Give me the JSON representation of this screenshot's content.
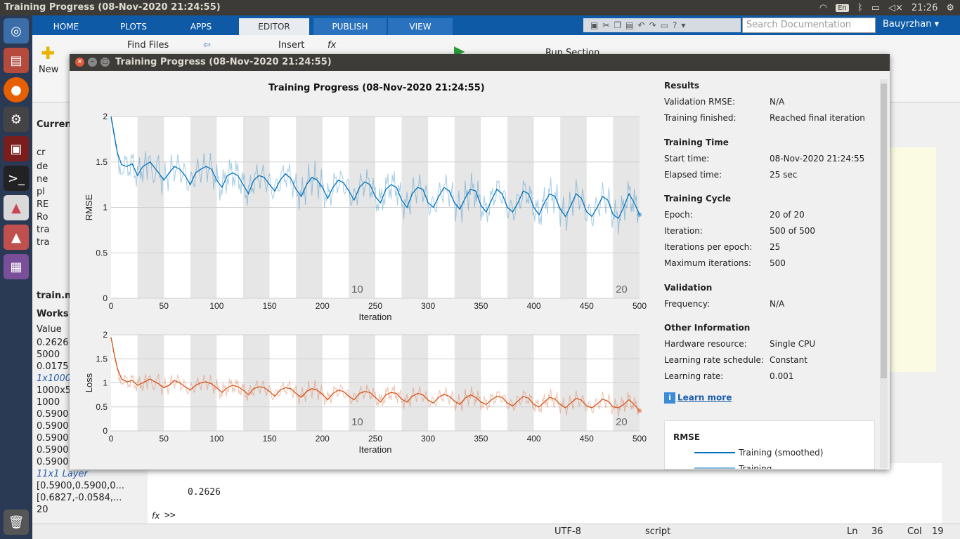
{
  "os": {
    "window_title": "Training Progress (08-Nov-2020 21:24:55)",
    "lang": "En",
    "clock": "21:26"
  },
  "matlab": {
    "tabs": [
      "HOME",
      "PLOTS",
      "APPS",
      "EDITOR",
      "PUBLISH",
      "VIEW"
    ],
    "active_tab": "EDITOR",
    "search_placeholder": "Search Documentation",
    "user": "Bauyrzhan",
    "ribbon": {
      "new": "New",
      "find_files": "Find Files",
      "insert": "Insert",
      "fx": "fx",
      "run_section": "Run Section"
    },
    "current_folder": "Curren",
    "file_rows": [
      "cr",
      "de",
      "ne",
      "pl",
      "RE",
      "Ro",
      "tra",
      "tra"
    ],
    "editor_file": "train.m",
    "workspace": "Works",
    "workspace_header": "Value",
    "workspace_values": [
      "0.2626",
      "5000",
      "0.0175",
      "1x1000",
      "1000x5",
      "1000",
      "0.5900",
      "0.5900",
      "0.5900",
      "0.5900",
      "0.5900",
      "11x1 Layer",
      "[0.5900,0.5900,0...",
      "[0.6827,-0.0584,...",
      "20"
    ],
    "cmd_output": "0.2626",
    "cmd_prompt": ">>",
    "cmd_fx": "fx",
    "status": {
      "encoding": "UTF-8",
      "type": "script",
      "ln_label": "Ln",
      "ln": "36",
      "col_label": "Col",
      "col": "19"
    }
  },
  "window": {
    "title": "Training Progress (08-Nov-2020 21:24:55)",
    "plot_title": "Training Progress (08-Nov-2020 21:24:55)"
  },
  "info": {
    "results_h": "Results",
    "validation_rmse_label": "Validation RMSE:",
    "validation_rmse": "N/A",
    "training_finished_label": "Training finished:",
    "training_finished": "Reached final iteration",
    "training_time_h": "Training Time",
    "start_time_label": "Start time:",
    "start_time": "08-Nov-2020 21:24:55",
    "elapsed_time_label": "Elapsed time:",
    "elapsed_time": "25 sec",
    "training_cycle_h": "Training Cycle",
    "epoch_label": "Epoch:",
    "epoch": "20 of 20",
    "iteration_label": "Iteration:",
    "iteration": "500 of 500",
    "iter_per_epoch_label": "Iterations per epoch:",
    "iter_per_epoch": "25",
    "max_iter_label": "Maximum iterations:",
    "max_iter": "500",
    "validation_h": "Validation",
    "frequency_label": "Frequency:",
    "frequency": "N/A",
    "other_h": "Other Information",
    "hardware_label": "Hardware resource:",
    "hardware": "Single CPU",
    "lr_schedule_label": "Learning rate schedule:",
    "lr_schedule": "Constant",
    "lr_label": "Learning rate:",
    "lr": "0.001",
    "learn_more": "Learn more",
    "legend_title": "RMSE",
    "legend_smoothed": "Training (smoothed)",
    "legend_training": "Training"
  },
  "chart_data": [
    {
      "type": "line",
      "ylabel": "RMSE",
      "xlabel": "Iteration",
      "xlim": [
        0,
        500
      ],
      "ylim": [
        0,
        2
      ],
      "xticks": [
        0,
        50,
        100,
        150,
        200,
        250,
        300,
        350,
        400,
        450,
        500
      ],
      "yticks": [
        0,
        0.5,
        1,
        1.5,
        2
      ],
      "epoch_labels": [
        "10",
        "20"
      ],
      "color": "#0072bd",
      "series": [
        {
          "name": "Training (smoothed)",
          "x": [
            0,
            3,
            6,
            10,
            15,
            20,
            25,
            30,
            37,
            45,
            50,
            55,
            60,
            65,
            70,
            75,
            80,
            85,
            90,
            95,
            100,
            105,
            110,
            115,
            120,
            125,
            130,
            135,
            140,
            145,
            150,
            155,
            160,
            165,
            170,
            175,
            180,
            185,
            190,
            195,
            200,
            205,
            210,
            215,
            220,
            225,
            230,
            235,
            240,
            245,
            250,
            255,
            260,
            265,
            270,
            275,
            280,
            285,
            290,
            295,
            300,
            305,
            310,
            315,
            320,
            325,
            330,
            335,
            340,
            345,
            350,
            355,
            360,
            365,
            370,
            375,
            380,
            385,
            390,
            395,
            400,
            405,
            410,
            415,
            420,
            425,
            430,
            435,
            440,
            445,
            450,
            455,
            460,
            465,
            470,
            475,
            480,
            485,
            490,
            495,
            500
          ],
          "y": [
            2.0,
            1.8,
            1.6,
            1.47,
            1.45,
            1.48,
            1.35,
            1.45,
            1.5,
            1.38,
            1.3,
            1.38,
            1.45,
            1.42,
            1.35,
            1.25,
            1.38,
            1.42,
            1.45,
            1.42,
            1.3,
            1.22,
            1.35,
            1.38,
            1.35,
            1.25,
            1.15,
            1.3,
            1.35,
            1.33,
            1.25,
            1.18,
            1.3,
            1.37,
            1.32,
            1.2,
            1.12,
            1.25,
            1.33,
            1.3,
            1.22,
            1.1,
            1.22,
            1.3,
            1.27,
            1.18,
            1.08,
            1.22,
            1.28,
            1.25,
            1.12,
            1.05,
            1.2,
            1.25,
            1.22,
            1.08,
            1.0,
            1.15,
            1.22,
            1.2,
            1.05,
            1.0,
            1.12,
            1.22,
            1.18,
            1.05,
            0.98,
            1.1,
            1.2,
            1.18,
            1.02,
            0.95,
            1.08,
            1.2,
            1.15,
            1.0,
            0.95,
            1.05,
            1.18,
            1.15,
            1.0,
            0.92,
            1.05,
            1.15,
            1.12,
            0.98,
            0.9,
            1.02,
            1.15,
            1.1,
            0.95,
            0.9,
            1.0,
            1.12,
            1.08,
            0.92,
            0.88,
            1.0,
            1.15,
            1.05,
            0.92
          ]
        }
      ]
    },
    {
      "type": "line",
      "ylabel": "Loss",
      "xlabel": "Iteration",
      "xlim": [
        0,
        500
      ],
      "ylim": [
        0,
        2
      ],
      "xticks": [
        0,
        50,
        100,
        150,
        200,
        250,
        300,
        350,
        400,
        450,
        500
      ],
      "yticks": [
        0,
        0.5,
        1,
        1.5,
        2
      ],
      "epoch_labels": [
        "10",
        "20"
      ],
      "color": "#d95319",
      "series": [
        {
          "name": "Training (smoothed)",
          "x": [
            0,
            3,
            6,
            10,
            15,
            20,
            25,
            30,
            37,
            45,
            50,
            55,
            60,
            65,
            70,
            75,
            80,
            85,
            90,
            95,
            100,
            105,
            110,
            115,
            120,
            125,
            130,
            135,
            140,
            145,
            150,
            155,
            160,
            165,
            170,
            175,
            180,
            185,
            190,
            195,
            200,
            205,
            210,
            215,
            220,
            225,
            230,
            235,
            240,
            245,
            250,
            255,
            260,
            265,
            270,
            275,
            280,
            285,
            290,
            295,
            300,
            305,
            310,
            315,
            320,
            325,
            330,
            335,
            340,
            345,
            350,
            355,
            360,
            365,
            370,
            375,
            380,
            385,
            390,
            395,
            400,
            405,
            410,
            415,
            420,
            425,
            430,
            435,
            440,
            445,
            450,
            455,
            460,
            465,
            470,
            475,
            480,
            485,
            490,
            495,
            500
          ],
          "y": [
            1.95,
            1.6,
            1.3,
            1.08,
            1.02,
            1.05,
            0.95,
            1.0,
            1.08,
            0.98,
            0.9,
            0.95,
            1.05,
            1.0,
            0.92,
            0.85,
            0.95,
            1.0,
            1.02,
            0.98,
            0.9,
            0.8,
            0.9,
            0.95,
            0.92,
            0.85,
            0.75,
            0.88,
            0.92,
            0.9,
            0.82,
            0.72,
            0.85,
            0.9,
            0.88,
            0.78,
            0.7,
            0.82,
            0.88,
            0.85,
            0.76,
            0.65,
            0.78,
            0.85,
            0.82,
            0.72,
            0.65,
            0.78,
            0.82,
            0.8,
            0.7,
            0.6,
            0.75,
            0.8,
            0.78,
            0.66,
            0.6,
            0.72,
            0.78,
            0.75,
            0.64,
            0.58,
            0.7,
            0.76,
            0.72,
            0.62,
            0.55,
            0.68,
            0.75,
            0.7,
            0.6,
            0.55,
            0.65,
            0.72,
            0.7,
            0.58,
            0.52,
            0.62,
            0.72,
            0.68,
            0.55,
            0.5,
            0.6,
            0.7,
            0.66,
            0.55,
            0.48,
            0.58,
            0.68,
            0.64,
            0.52,
            0.48,
            0.56,
            0.66,
            0.62,
            0.5,
            0.48,
            0.55,
            0.65,
            0.55,
            0.42
          ]
        }
      ]
    }
  ]
}
